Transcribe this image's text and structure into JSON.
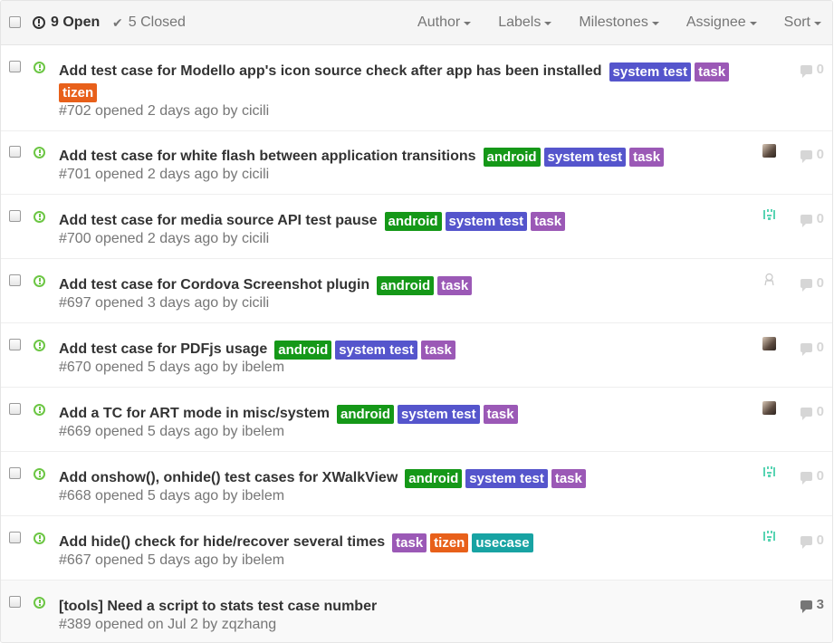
{
  "header": {
    "open_label": "9 Open",
    "closed_label": "5 Closed",
    "filters": [
      "Author",
      "Labels",
      "Milestones",
      "Assignee",
      "Sort"
    ]
  },
  "colors": {
    "android": "#159818",
    "system test": "#5555cc",
    "task": "#9b59b6",
    "tizen": "#e8601a",
    "usecase": "#18a3a3"
  },
  "issues": [
    {
      "title": "Add test case for Modello app's icon source check after app has been installed",
      "labels": [
        "system test",
        "task",
        "tizen"
      ],
      "meta": "#702 opened 2 days ago by ",
      "author": "cicili",
      "avatar": "none",
      "comments": "0"
    },
    {
      "title": "Add test case for white flash between application transitions",
      "labels": [
        "android",
        "system test",
        "task"
      ],
      "meta": "#701 opened 2 days ago by ",
      "author": "cicili",
      "avatar": "photo",
      "comments": "0"
    },
    {
      "title": "Add test case for media source API test pause",
      "labels": [
        "android",
        "system test",
        "task"
      ],
      "meta": "#700 opened 2 days ago by ",
      "author": "cicili",
      "avatar": "identicon",
      "comments": "0"
    },
    {
      "title": "Add test case for Cordova Screenshot plugin",
      "labels": [
        "android",
        "task"
      ],
      "meta": "#697 opened 3 days ago by ",
      "author": "cicili",
      "avatar": "ghost",
      "comments": "0"
    },
    {
      "title": "Add test case for PDFjs usage",
      "labels": [
        "android",
        "system test",
        "task"
      ],
      "meta": "#670 opened 5 days ago by ",
      "author": "ibelem",
      "avatar": "photo",
      "comments": "0"
    },
    {
      "title": "Add a TC for ART mode in misc/system",
      "labels": [
        "android",
        "system test",
        "task"
      ],
      "meta": "#669 opened 5 days ago by ",
      "author": "ibelem",
      "avatar": "photo",
      "comments": "0"
    },
    {
      "title": "Add onshow(), onhide() test cases for XWalkView",
      "labels": [
        "android",
        "system test",
        "task"
      ],
      "meta": "#668 opened 5 days ago by ",
      "author": "ibelem",
      "avatar": "identicon",
      "comments": "0"
    },
    {
      "title": "Add hide() check for hide/recover several times",
      "labels": [
        "task",
        "tizen",
        "usecase"
      ],
      "meta": "#667 opened 5 days ago by ",
      "author": "ibelem",
      "avatar": "identicon",
      "comments": "0"
    },
    {
      "title": "[tools] Need a script to stats test case number",
      "labels": [],
      "meta": "#389 opened on Jul 2 by ",
      "author": "zqzhang",
      "avatar": "none",
      "comments": "3"
    }
  ]
}
